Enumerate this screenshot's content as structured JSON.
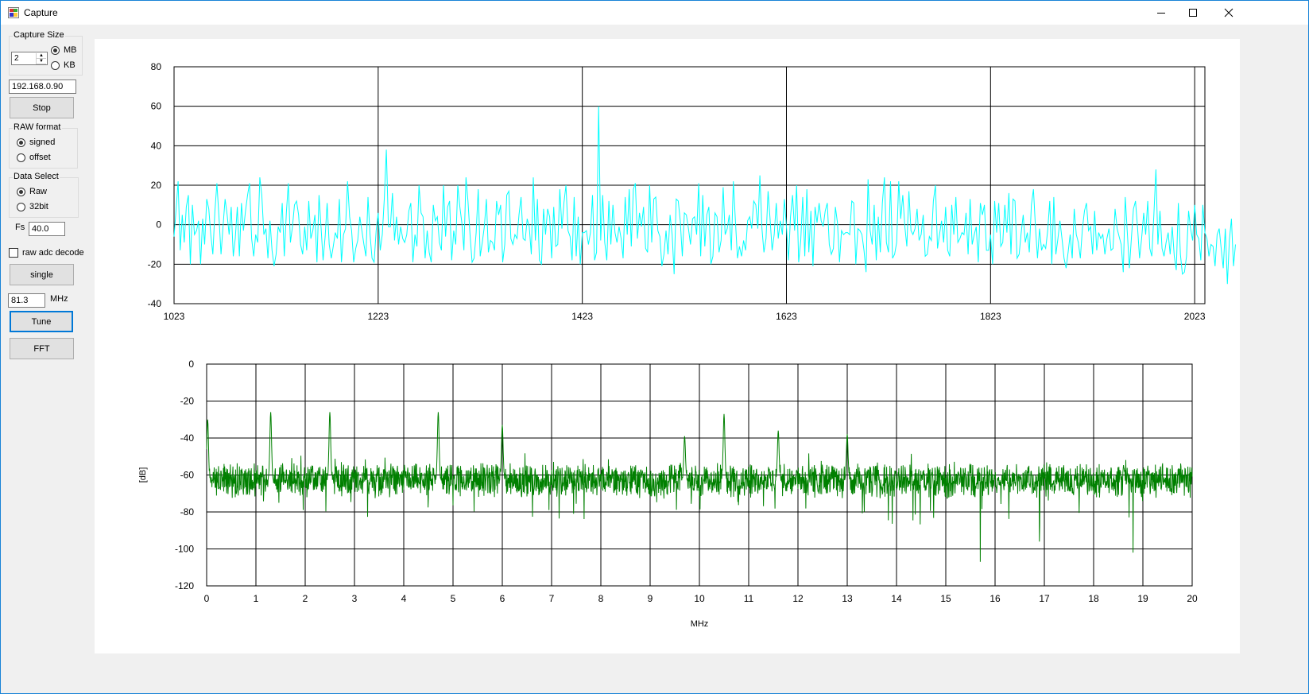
{
  "window": {
    "title": "Capture"
  },
  "titlebar_buttons": [
    {
      "name": "minimize",
      "icon": "minimize-icon"
    },
    {
      "name": "maximize",
      "icon": "maximize-icon"
    },
    {
      "name": "close",
      "icon": "close-icon"
    }
  ],
  "capture_size": {
    "label": "Capture Size",
    "value": "2",
    "options": [
      {
        "label": "MB",
        "checked": true
      },
      {
        "label": "KB",
        "checked": false
      }
    ]
  },
  "ip_address": "192.168.0.90",
  "stop_label": "Stop",
  "raw_format": {
    "label": "RAW format",
    "options": [
      {
        "label": "signed",
        "checked": true
      },
      {
        "label": "offset",
        "checked": false
      }
    ]
  },
  "data_select": {
    "label": "Data Select",
    "options": [
      {
        "label": "Raw",
        "checked": true
      },
      {
        "label": "32bit",
        "checked": false
      }
    ]
  },
  "fs": {
    "label": "Fs",
    "value": "40.0"
  },
  "raw_adc_decode": {
    "label": "raw adc decode",
    "checked": false
  },
  "single_label": "single",
  "freq": {
    "value": "81.3",
    "unit": "MHz"
  },
  "tune_label": "Tune",
  "fft_label": "FFT",
  "colors": {
    "time_series": "#00ffff",
    "spectrum": "#008000"
  },
  "chart_data": [
    {
      "type": "line",
      "title": "",
      "xlabel": "",
      "ylabel": "",
      "xlim": [
        1023,
        2033
      ],
      "ylim": [
        -40,
        80
      ],
      "x_ticks": [
        1023,
        1223,
        1423,
        1623,
        1823,
        2023
      ],
      "y_ticks": [
        80,
        60,
        40,
        20,
        0,
        -20,
        -40
      ],
      "grid": true,
      "series": [
        {
          "x_start": 1023,
          "x_step": 2,
          "values": [
            -6,
            8,
            22,
            -13,
            5,
            -9,
            9,
            15,
            -20,
            10,
            -5,
            -3,
            2,
            -20,
            3,
            -10,
            13,
            8,
            -5,
            -15,
            7,
            21,
            4,
            -15,
            -1,
            13,
            5,
            -5,
            9,
            -16,
            -7,
            9,
            -16,
            11,
            -3,
            7,
            15,
            21,
            -7,
            -16,
            -5,
            -9,
            24,
            15,
            -5,
            -2,
            -17,
            2,
            -13,
            -21,
            -15,
            -1,
            -4,
            11,
            -16,
            6,
            21,
            -9,
            -1,
            10,
            12,
            5,
            -10,
            -15,
            -1,
            -13,
            12,
            -7,
            -3,
            5,
            -19,
            15,
            -1,
            -18,
            -6,
            11,
            -10,
            -17,
            -11,
            -4,
            -7,
            13,
            -19,
            -5,
            -2,
            22,
            4,
            -3,
            -19,
            -12,
            -8,
            4,
            -3,
            -10,
            -16,
            14,
            -5,
            -17,
            -19,
            -3,
            6,
            -13,
            -5,
            13,
            38,
            -1,
            -1,
            16,
            -8,
            4,
            -10,
            -1,
            -7,
            -9,
            -5,
            7,
            11,
            -19,
            -5,
            -11,
            20,
            6,
            4,
            -17,
            -3,
            -14,
            -19,
            10,
            2,
            4,
            -9,
            -13,
            20,
            -6,
            9,
            12,
            -18,
            -3,
            -10,
            20,
            9,
            1,
            -13,
            24,
            12,
            -5,
            -19,
            -17,
            -4,
            18,
            -16,
            -9,
            -1,
            13,
            -14,
            -8,
            -9,
            -13,
            12,
            5,
            10,
            -19,
            -10,
            15,
            17,
            -7,
            -10,
            -5,
            -7,
            5,
            14,
            -7,
            -8,
            3,
            -1,
            -15,
            24,
            -8,
            13,
            -18,
            -20,
            8,
            -5,
            8,
            4,
            -17,
            9,
            -11,
            -10,
            18,
            -2,
            11,
            20,
            -3,
            -6,
            -18,
            14,
            -16,
            4,
            -20,
            -4,
            -4,
            -3,
            -10,
            -4,
            15,
            -18,
            -14,
            60,
            -8,
            15,
            -9,
            -18,
            12,
            -10,
            10,
            -4,
            -9,
            -1,
            -7,
            -17,
            14,
            -5,
            18,
            -11,
            18,
            21,
            -7,
            6,
            -1,
            9,
            -12,
            -14,
            20,
            -9,
            13,
            14,
            -3,
            -6,
            -21,
            -15,
            -3,
            -15,
            5,
            -5,
            -25,
            13,
            12,
            2,
            -16,
            6,
            5,
            -2,
            -10,
            3,
            4,
            -5,
            21,
            -16,
            15,
            -11,
            5,
            9,
            -20,
            -16,
            6,
            4,
            -14,
            -8,
            19,
            -5,
            -2,
            5,
            -13,
            22,
            2,
            -17,
            -11,
            -16,
            -8,
            -13,
            2,
            4,
            -2,
            12,
            10,
            -2,
            25,
            -2,
            -14,
            -7,
            17,
            3,
            -13,
            -5,
            11,
            -7,
            2,
            -5,
            13,
            -1,
            -18,
            4,
            15,
            -3,
            20,
            -19,
            -8,
            14,
            -16,
            18,
            -14,
            7,
            -21,
            9,
            1,
            11,
            2,
            -1,
            7,
            11,
            -10,
            -15,
            -12,
            9,
            1,
            -19,
            -3,
            -5,
            -4,
            -4,
            -5,
            12,
            11,
            -20,
            -2,
            -3,
            -5,
            -13,
            -24,
            23,
            -3,
            -10,
            10,
            -18,
            4,
            -14,
            11,
            24,
            -9,
            -14,
            22,
            -17,
            -15,
            -9,
            22,
            3,
            15,
            -1,
            -11,
            17,
            -3,
            -5,
            -2,
            8,
            -8,
            -5,
            5,
            -16,
            -15,
            -6,
            -8,
            12,
            20,
            -12,
            -5,
            2,
            -9,
            9,
            -13,
            -16,
            10,
            -5,
            14,
            -9,
            -7,
            -4,
            -5,
            6,
            -15,
            13,
            -10,
            -5,
            -1,
            -19,
            11,
            5,
            10,
            -13,
            -13,
            -5,
            -20,
            12,
            -4,
            11,
            -11,
            -9,
            10,
            -4,
            16,
            -15,
            13,
            12,
            -17,
            -15,
            -4,
            5,
            -9,
            -4,
            -14,
            10,
            18,
            -1,
            -17,
            -2,
            -13,
            -10,
            -12,
            -3,
            12,
            -20,
            14,
            -15,
            -7,
            2,
            -7,
            -17,
            -22,
            -14,
            -5,
            -17,
            8,
            -5,
            -9,
            -17,
            -2,
            7,
            11,
            -3,
            -1,
            -15,
            7,
            -13,
            -4,
            -7,
            -5,
            -15,
            -7,
            -2,
            -13,
            -12,
            8,
            -2,
            -6,
            -10,
            -24,
            14,
            -4,
            -22,
            -7,
            8,
            12,
            -1,
            -17,
            -7,
            6,
            -5,
            12,
            -12,
            -16,
            5,
            28,
            -10,
            7,
            -12,
            -16,
            -9,
            -4,
            -15,
            -1,
            -16,
            -23,
            11,
            -15,
            -25,
            -24,
            -16,
            7,
            -2,
            -8,
            10,
            -5,
            -7,
            -18,
            10,
            -4,
            -7,
            -16,
            -10,
            -11,
            -21,
            -5,
            -2,
            -12,
            -22,
            -2,
            -30,
            -8,
            3,
            -21,
            -10
          ]
        }
      ]
    },
    {
      "type": "line",
      "title": "",
      "xlabel": "MHz",
      "ylabel": "[dB]",
      "xlim": [
        0,
        20
      ],
      "ylim": [
        -120,
        0
      ],
      "x_ticks": [
        0,
        1,
        2,
        3,
        4,
        5,
        6,
        7,
        8,
        9,
        10,
        11,
        12,
        13,
        14,
        15,
        16,
        17,
        18,
        19,
        20
      ],
      "y_ticks": [
        0,
        -20,
        -40,
        -60,
        -80,
        -100,
        -120
      ],
      "grid": true,
      "noise_floor_db": -63,
      "spurs": [
        {
          "mhz": 0.02,
          "db": -30
        },
        {
          "mhz": 1.3,
          "db": -26
        },
        {
          "mhz": 2.5,
          "db": -26
        },
        {
          "mhz": 4.7,
          "db": -26
        },
        {
          "mhz": 6.0,
          "db": -33
        },
        {
          "mhz": 9.7,
          "db": -39
        },
        {
          "mhz": 10.5,
          "db": -27
        },
        {
          "mhz": 11.6,
          "db": -36
        },
        {
          "mhz": 13.0,
          "db": -38
        }
      ],
      "dips": [
        {
          "mhz": 15.7,
          "db": -107
        },
        {
          "mhz": 18.8,
          "db": -102
        },
        {
          "mhz": 16.9,
          "db": -96
        }
      ]
    }
  ]
}
